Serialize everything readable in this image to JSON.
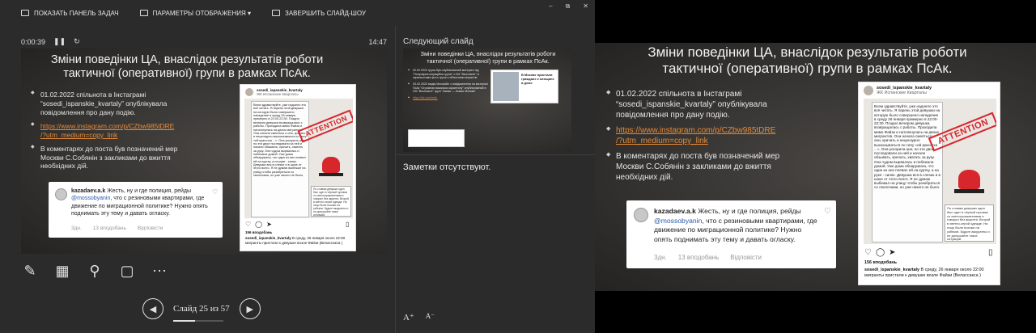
{
  "toolbar": {
    "show_taskbar": "ПОКАЗАТЬ ПАНЕЛЬ ЗАДАЧ",
    "display_settings": "ПАРАМЕТРЫ ОТОБРАЖЕНИЯ ▾",
    "end_show": "ЗАВЕРШИТЬ СЛАЙД-ШОУ",
    "window_controls": [
      "–",
      "⧉",
      "✕"
    ]
  },
  "presenter": {
    "elapsed": "0:00:39",
    "clock": "14:47",
    "next_slide_label": "Следующий слайд",
    "notes": "Заметки отсутствуют.",
    "slide_counter": "Слайд 25 из 57",
    "slide_progress": 0.44,
    "font_increase": "A⁺",
    "font_decrease": "A⁻"
  },
  "slide": {
    "title_line1": "Зміни поведінки ЦА, внаслідок результатів роботи",
    "title_line2": "тактичної (оперативної) групи в рамках ПсАк.",
    "bullet1": "01.02.2022 спільнота в Інстаграмі “sosedi_ispanskie_kvartaly” опублікувала повідомлення про дану подію.",
    "link_line1": "https://www.instagram.com/p/CZbw985tDRE",
    "link_line2": "/?utm_medium=copy_link",
    "bullet3": "В коментарях до поста був позначений мер Москви С.Собянін з закликами до вжиття необхідних дій.",
    "comment": {
      "user": "kazadaev.a.k",
      "text_before": " Жесть, ну и где полиция, рейды ",
      "mention": "@mossobyanin",
      "text_after": ", что с резиновыми квартирами, где движение по миграционной политике? Нужно опять поднимать эту тему и давать огласку.",
      "age": "3дн.",
      "likes": "13 вподобань",
      "reply": "Відповісти"
    },
    "post": {
      "user": "sosedi_ispanskie_kvartaly",
      "location": "ЖК Испанские Кварталы",
      "stamp": "ATTENTION",
      "doc_text": "Всем здравствуйте, уже надоело это всё читать. Я парень этой девушки на которую было совершено нападение в среду 26 января примерно в 22:00-22:30. Поздно вечером девушка возвращалась с работы. Проходила мимо Файзи и натолкнулась на двоих мигрантов. Она начала смеяться и они, кричать и нецензурно высказываться по типу «ей красотка ...». Она ускорила шаг, но эти двое последовали за ней и начали обзывать, кричать, хватать за руку. Она чудом вырвалась и побежала домой. Уже дома обнаружила, что один из них плевал ей на куртку, а на руке - синяк. Девушка вся в слезах и в шоке от этого всего. Я не думаю выбежал на улицу чтобы разобраться со сволочами, но уже никого не было.",
      "note_text": "По словам девушки один был одет в чёрный пуховик со светоотражателями и говорил без акцента. Второй в светло-серой одежде. На лицо были похожи на узбеков. Будьте аккуратны и не допускайте таких ситуаций.",
      "likes": "156 вподобань",
      "caption_user": "sosedi_ispanskie_kvartaly",
      "caption": " В среду, 26 января около 22:00 мигранты пристали к девушке возле Файзи (Велассакса )"
    }
  },
  "thumb": {
    "title": "Зміни поведінки ЦА, внаслідок результатів роботи тактичної (оперативної) групи в рамках ПсАк.",
    "bullet1": "02.02.2022 група був опублікований матеріал під “Популярна міграційна група” з СМ “Вконтакте” зі скриншотами фото групи з обличчями мігрантів",
    "bullet2": "03.02.2022 медіа МосмАйл з повідомлення на матеріал ПсАк “Огромная вакансия карантину” опублікований в СМ “Вконтакте” групі “Химки — Новая Москва”",
    "link": "https://vk.com/wall-",
    "headline": "В Москве пристали граждане к женщине в доме"
  },
  "tools": [
    "pen-icon",
    "slides-icon",
    "zoom-icon",
    "screen-icon",
    "more-icon"
  ]
}
